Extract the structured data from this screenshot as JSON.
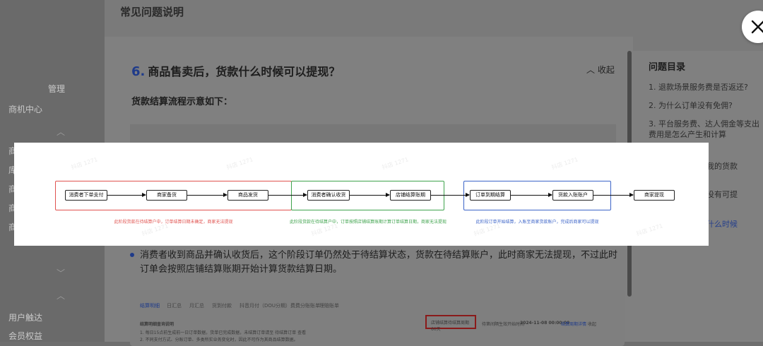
{
  "background": {
    "left_nav": {
      "items": [
        {
          "label": "管理"
        },
        {
          "label": "商机中心"
        },
        {
          "label": "商"
        },
        {
          "label": "库"
        },
        {
          "label": "商"
        },
        {
          "label": "商"
        },
        {
          "label": "商"
        },
        {
          "label": "用户触达"
        },
        {
          "label": "会员权益"
        }
      ]
    }
  },
  "drawer": {
    "title": "常见问题说明",
    "question": {
      "number": "6.",
      "text": "商品售卖后，货款什么时候可以提现？"
    },
    "collapse_label": "收起",
    "subheading": "货款结算流程示意如下：",
    "bullet_text": "消费者收到商品并确认收货后，这个阶段订单仍然处于待结算状态，货款在待结算账户，此时商家无法提现，不过此时订单会按照店铺结算账期开始计算货款结算日期。",
    "toc": {
      "title": "问题目录",
      "items": [
        {
          "label": "1. 退款场景服务费是否返还?"
        },
        {
          "label": "2. 为什么订单没有免佣?"
        },
        {
          "label": "3. 平台服务费、达人佣金等支出费用是怎么产生和计算"
        },
        {
          "label": "单和我的货款"
        },
        {
          "label": "什么没有可提"
        },
        {
          "label": "货款什么时候"
        }
      ]
    },
    "inner_screenshot": {
      "tabs": [
        {
          "label": "结算明细"
        },
        {
          "label": "日汇总"
        },
        {
          "label": "月汇总"
        },
        {
          "label": "货到付款"
        },
        {
          "label": "抖音月付（DOU分期）费费分账账单"
        },
        {
          "label": "理赔账单"
        }
      ],
      "section_title": "结算明细查询说明",
      "lines": [
        "1. 每日15点前生成前一日订单数据，货单已完成数据，未结算订单请至 待结算订单 查看",
        "2. 不同支付方式、分账订单、多类所实业务变化时，因此不可作为其商品结算数据。"
      ],
      "highlight_text": "店铺结算待结算周期 60天",
      "extra_text": "待第间隔生效开始时间",
      "date_text": "2024-11-08 00:00:00",
      "link_text": "结算周期详情",
      "collapse_text": "收起"
    }
  },
  "flow_image": {
    "groups": [
      {
        "color": "#e0524f",
        "nodes": [
          "消费者下单支付",
          "商家备货",
          "商品发货"
        ],
        "note": "此阶段货款在待结算户中，订单结算日期未确定，商家无法提现"
      },
      {
        "color": "#3fa34d",
        "nodes": [
          "消费者确认收货",
          "店铺结算账期"
        ],
        "note": "此阶段货款在待结算户中，订单按照店铺结算账期计算订单结算日期，商家无法提现"
      },
      {
        "color": "#3c64c8",
        "nodes": [
          "订单到期结算",
          "货款入账账户"
        ],
        "note": "此阶段订单开始结算，入账至商家货款账户，完成后商家可以提现"
      }
    ],
    "final_node": "商家提现",
    "watermark": "抖店 1271"
  },
  "close": {
    "icon": "close-icon"
  }
}
